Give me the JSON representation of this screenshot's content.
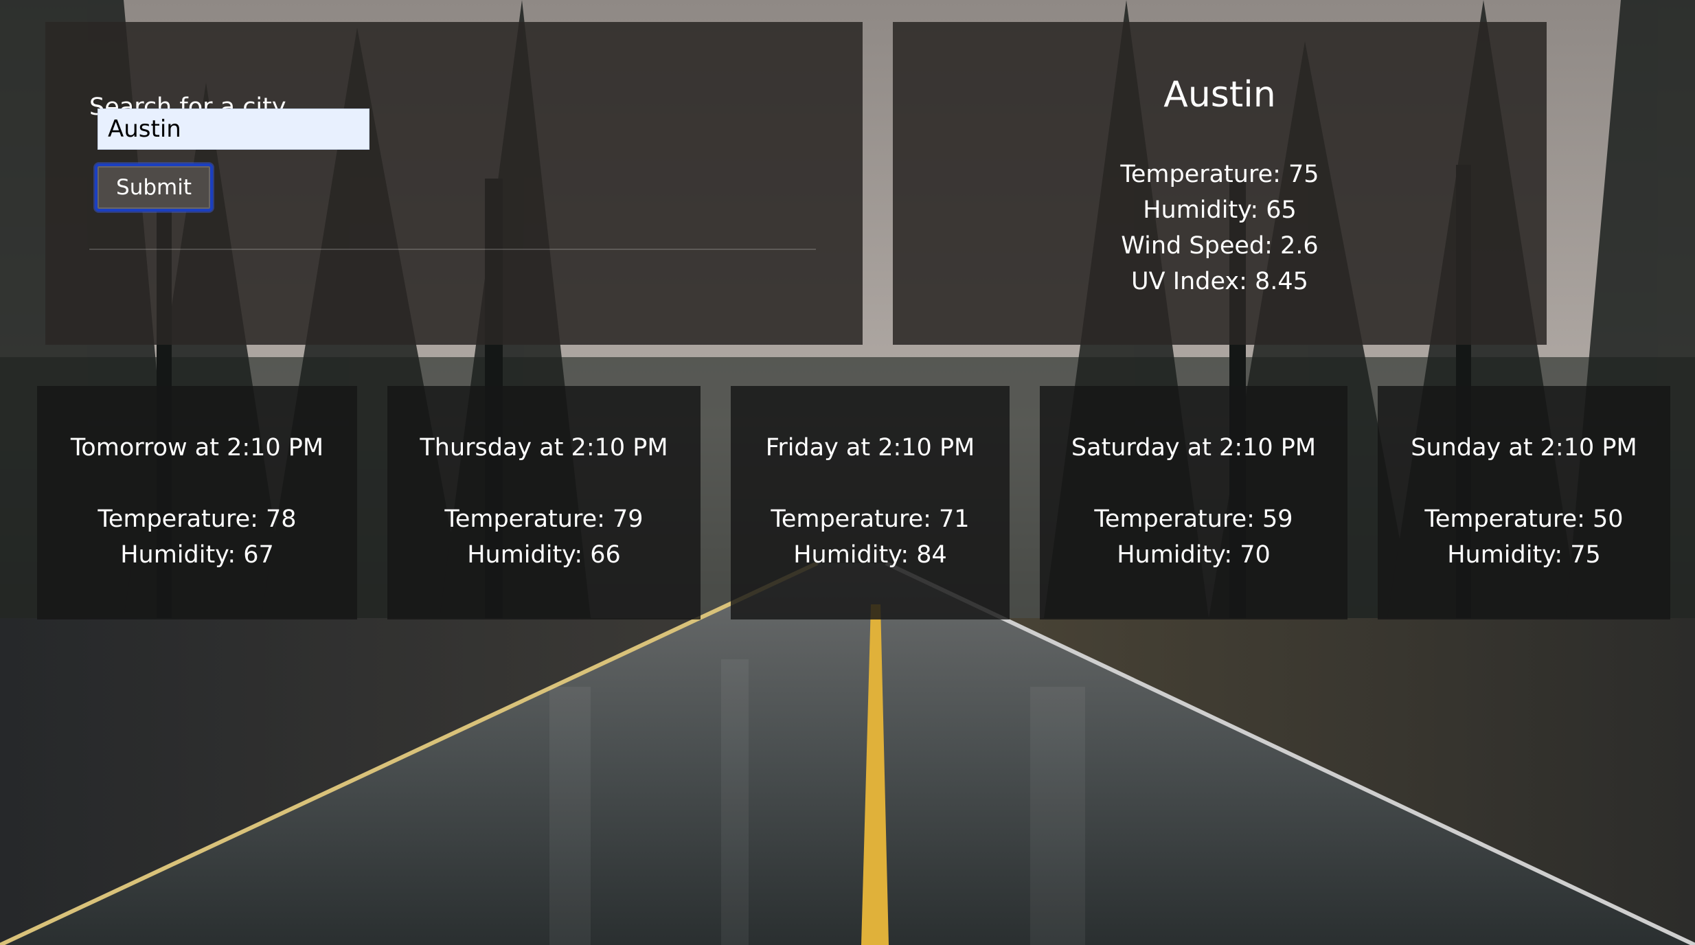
{
  "search": {
    "label": "Search for a city",
    "value": "Austin",
    "submit_label": "Submit"
  },
  "current": {
    "city": "Austin",
    "temperature": "Temperature: 75",
    "humidity": "Humidity: 65",
    "wind_speed": "Wind Speed: 2.6",
    "uv_index": "UV Index: 8.45"
  },
  "forecast": [
    {
      "day": "Tomorrow at 2:10 PM",
      "temperature": "Temperature: 78",
      "humidity": "Humidity: 67"
    },
    {
      "day": "Thursday at 2:10 PM",
      "temperature": "Temperature: 79",
      "humidity": "Humidity: 66"
    },
    {
      "day": "Friday at 2:10 PM",
      "temperature": "Temperature: 71",
      "humidity": "Humidity: 84"
    },
    {
      "day": "Saturday at 2:10 PM",
      "temperature": "Temperature: 59",
      "humidity": "Humidity: 70"
    },
    {
      "day": "Sunday at 2:10 PM",
      "temperature": "Temperature: 50",
      "humidity": "Humidity: 75"
    }
  ],
  "colors": {
    "panel_bg": "#2a2624",
    "card_bg": "#161616",
    "input_bg": "#e8f0fe",
    "button_bg": "#4f4b48",
    "button_focus_ring": "#1b3fc0",
    "road_line": "#e0b13a"
  }
}
